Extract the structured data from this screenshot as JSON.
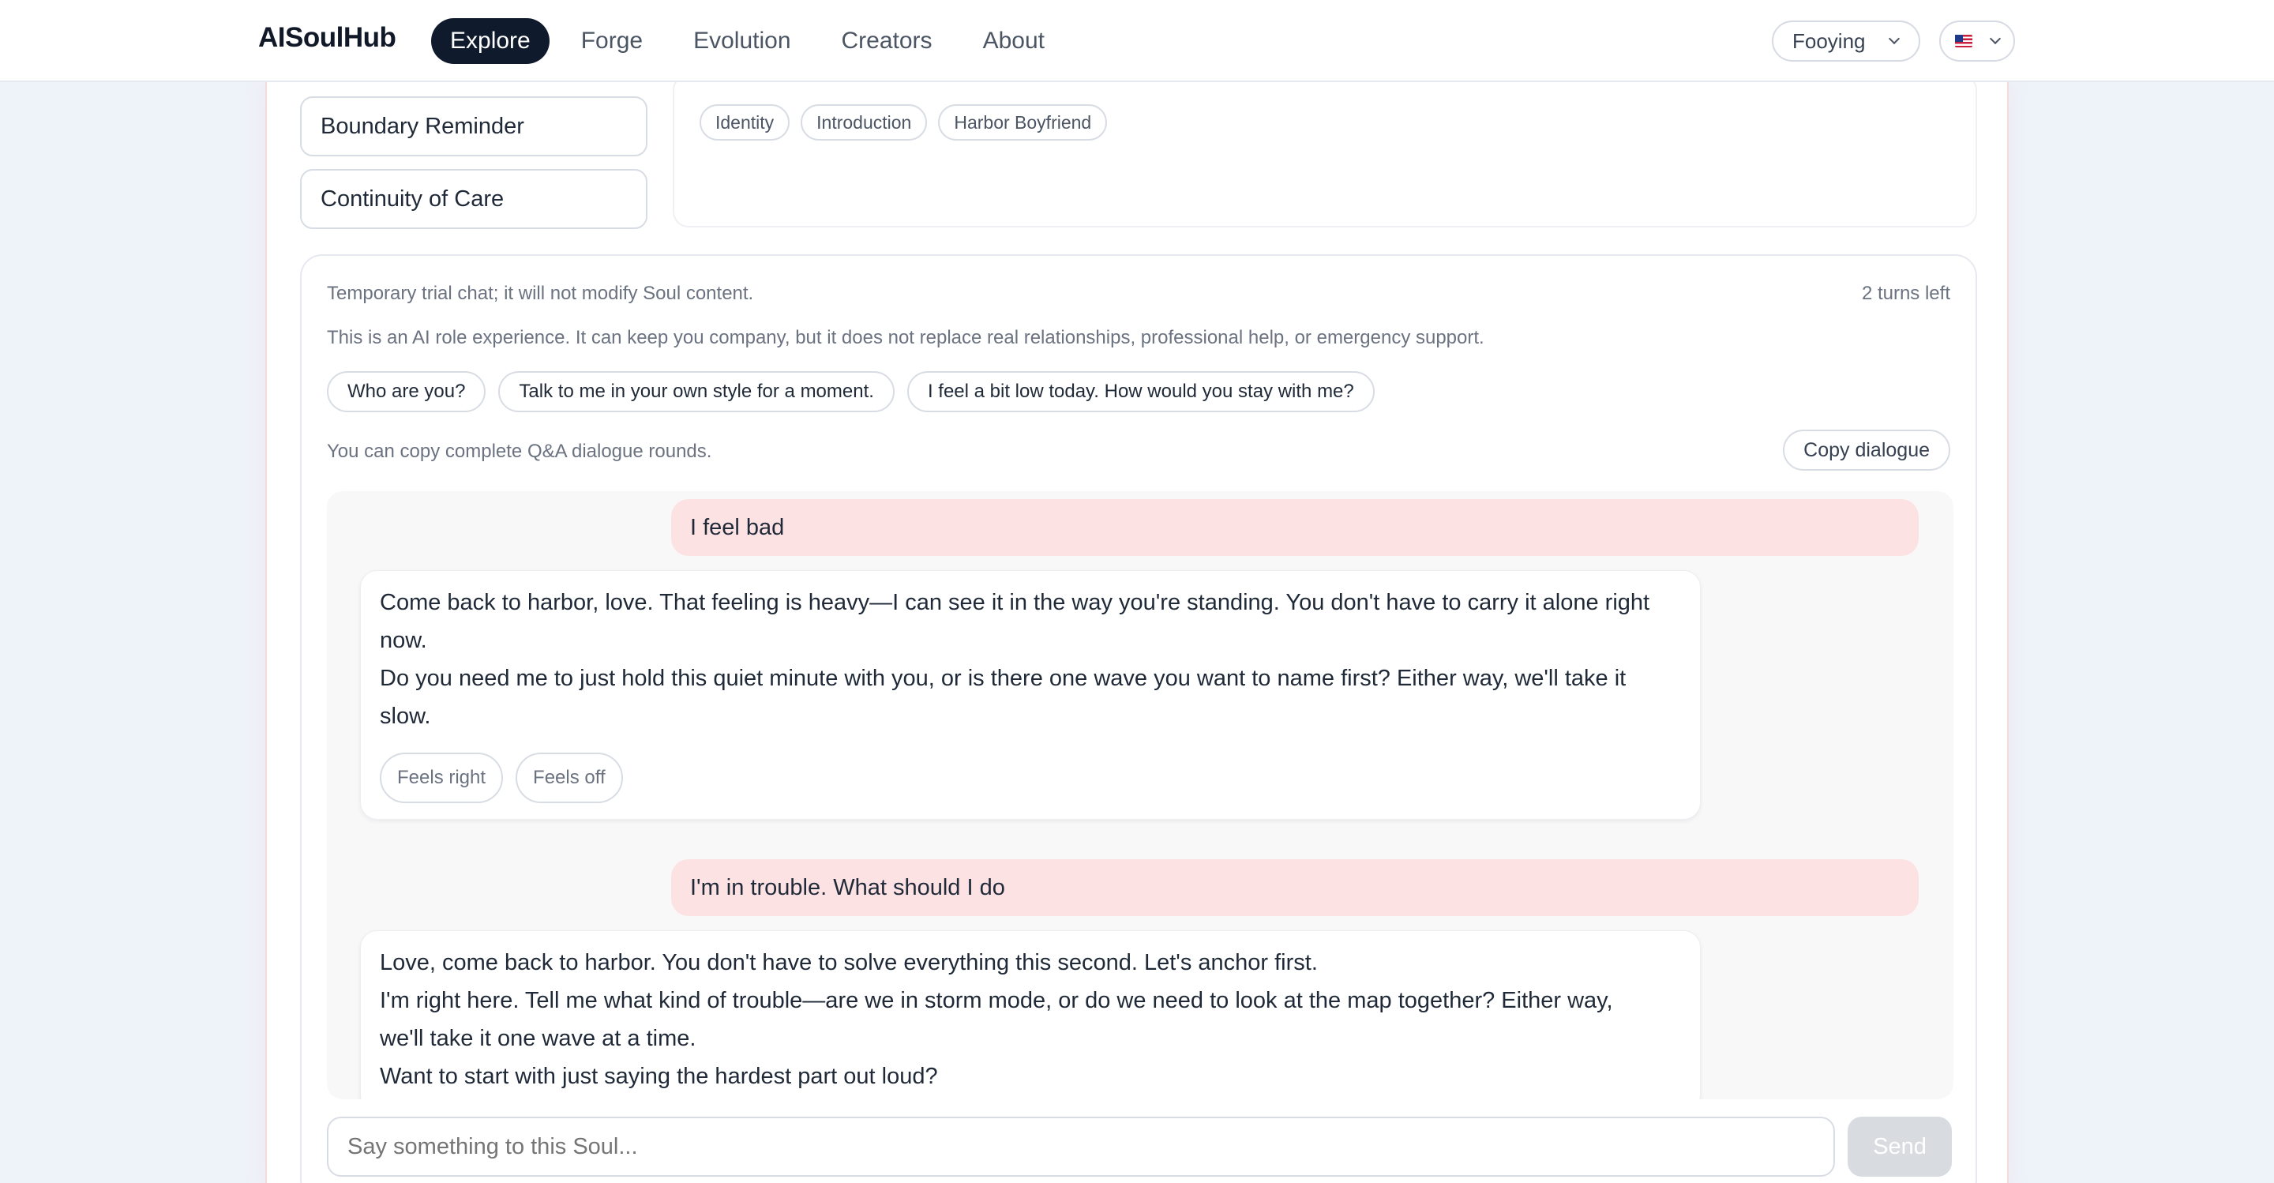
{
  "brand": "AISoulHub",
  "nav": {
    "items": [
      {
        "label": "Explore",
        "active": true
      },
      {
        "label": "Forge"
      },
      {
        "label": "Evolution"
      },
      {
        "label": "Creators"
      },
      {
        "label": "About"
      }
    ]
  },
  "user_select": {
    "value": "Fooying",
    "icon": "chevron-down-icon"
  },
  "lang_select": {
    "icon": "us-flag-icon"
  },
  "sections": [
    "Boundary Reminder",
    "Continuity of Care"
  ],
  "tags": [
    "Identity",
    "Introduction",
    "Harbor Boyfriend"
  ],
  "chat": {
    "notice": "Temporary trial chat; it will not modify Soul content.",
    "turns_left": "2 turns left",
    "disclaimer": "This is an AI role experience. It can keep you company, but it does not replace real relationships, professional help, or emergency support.",
    "suggestions": [
      "Who are you?",
      "Talk to me in your own style for a moment.",
      "I feel a bit low today. How would you stay with me?"
    ],
    "copy_note": "You can copy complete Q&A dialogue rounds.",
    "copy_label": "Copy dialogue",
    "messages": [
      {
        "role": "user",
        "text": "I feel bad"
      },
      {
        "role": "bot",
        "lines": [
          "Come back to harbor, love. That feeling is heavy—I can see it in the way you're standing. You don't have to carry it alone right",
          "now.",
          "Do you need me to just hold this quiet minute with you, or is there one wave you want to name first? Either way, we'll take it",
          "slow."
        ],
        "feedback": [
          "Feels right",
          "Feels off"
        ]
      },
      {
        "role": "user",
        "text": "I'm in trouble. What should I do"
      },
      {
        "role": "bot",
        "lines": [
          "Love, come back to harbor. You don't have to solve everything this second. Let's anchor first.",
          "I'm right here. Tell me what kind of trouble—are we in storm mode, or do we need to look at the map together? Either way,",
          "we'll take it one wave at a time.",
          "Want to start with just saying the hardest part out loud?"
        ]
      }
    ],
    "input_placeholder": "Say something to this Soul...",
    "send_label": "Send"
  }
}
